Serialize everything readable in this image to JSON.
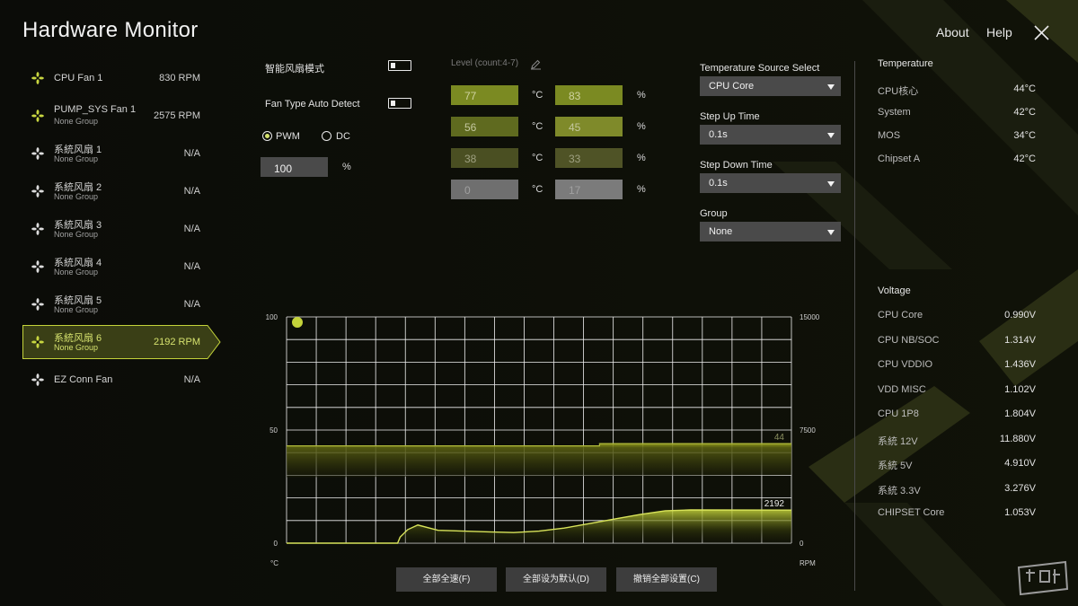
{
  "app": {
    "title": "Hardware Monitor",
    "about": "About",
    "help": "Help"
  },
  "fans": [
    {
      "name": "CPU Fan 1",
      "group": "",
      "value": "830 RPM",
      "active": false
    },
    {
      "name": "PUMP_SYS Fan 1",
      "group": "None Group",
      "value": "2575 RPM",
      "active": false
    },
    {
      "name": "系統风扇 1",
      "group": "None Group",
      "value": "N/A",
      "active": false
    },
    {
      "name": "系統风扇 2",
      "group": "None Group",
      "value": "N/A",
      "active": false
    },
    {
      "name": "系統风扇 3",
      "group": "None Group",
      "value": "N/A",
      "active": false
    },
    {
      "name": "系統风扇 4",
      "group": "None Group",
      "value": "N/A",
      "active": false
    },
    {
      "name": "系統风扇 5",
      "group": "None Group",
      "value": "N/A",
      "active": false
    },
    {
      "name": "系統风扇 6",
      "group": "None Group",
      "value": "2192 RPM",
      "active": true
    },
    {
      "name": "EZ Conn Fan",
      "group": "",
      "value": "N/A",
      "active": false
    }
  ],
  "settings": {
    "smart_fan_label": "智能风扇模式",
    "auto_detect_label": "Fan Type Auto Detect",
    "pwm_label": "PWM",
    "dc_label": "DC",
    "selected_mode": "PWM",
    "duty_value": "100",
    "duty_unit": "%"
  },
  "levels": {
    "header": "Level (count:4-7)",
    "temp_unit": "°C",
    "speed_unit": "%",
    "rows": [
      {
        "temp": "77",
        "speed": "83"
      },
      {
        "temp": "56",
        "speed": "45"
      },
      {
        "temp": "38",
        "speed": "33"
      },
      {
        "temp": "0",
        "speed": "17"
      }
    ]
  },
  "selects": {
    "temp_source_label": "Temperature Source Select",
    "temp_source_value": "CPU Core",
    "step_up_label": "Step Up Time",
    "step_up_value": "0.1s",
    "step_down_label": "Step Down Time",
    "step_down_value": "0.1s",
    "group_label": "Group",
    "group_value": "None"
  },
  "temperature": {
    "title": "Temperature",
    "items": [
      {
        "name": "CPU核心",
        "value": "44°C"
      },
      {
        "name": "System",
        "value": "42°C"
      },
      {
        "name": "MOS",
        "value": "34°C"
      },
      {
        "name": "Chipset A",
        "value": "42°C"
      }
    ]
  },
  "voltage": {
    "title": "Voltage",
    "items": [
      {
        "name": "CPU Core",
        "value": "0.990V"
      },
      {
        "name": "CPU NB/SOC",
        "value": "1.314V"
      },
      {
        "name": "CPU VDDIO",
        "value": "1.436V"
      },
      {
        "name": "VDD MISC",
        "value": "1.102V"
      },
      {
        "name": "CPU 1P8",
        "value": "1.804V"
      },
      {
        "name": "系統 12V",
        "value": "11.880V"
      },
      {
        "name": "系統 5V",
        "value": "4.910V"
      },
      {
        "name": "系統 3.3V",
        "value": "3.276V"
      },
      {
        "name": "CHIPSET Core",
        "value": "1.053V"
      }
    ]
  },
  "chart_data": {
    "type": "line",
    "left_axis": {
      "unit": "°C",
      "ticks": [
        "0",
        "50",
        "100"
      ],
      "range": [
        0,
        100
      ]
    },
    "right_axis": {
      "unit": "RPM",
      "ticks": [
        "0",
        "7500",
        "15000"
      ],
      "range": [
        0,
        15000
      ]
    },
    "series": [
      {
        "axis": "left",
        "current_label": "44",
        "points": [
          [
            0,
            43
          ],
          [
            62,
            43
          ],
          [
            62,
            44
          ],
          [
            100,
            44
          ]
        ]
      },
      {
        "axis": "right",
        "current_label": "2192",
        "points": [
          [
            0,
            0
          ],
          [
            22,
            0
          ],
          [
            22.5,
            400
          ],
          [
            24,
            900
          ],
          [
            26,
            1200
          ],
          [
            30,
            850
          ],
          [
            40,
            750
          ],
          [
            45,
            700
          ],
          [
            50,
            800
          ],
          [
            55,
            1000
          ],
          [
            60,
            1300
          ],
          [
            65,
            1600
          ],
          [
            70,
            1900
          ],
          [
            75,
            2150
          ],
          [
            80,
            2200
          ],
          [
            100,
            2192
          ]
        ]
      }
    ]
  },
  "buttons": {
    "full_speed": "全部全速(F)",
    "set_default": "全部设为默认(D)",
    "undo_all": "撤销全部设置(C)"
  },
  "colors": {
    "accent": "#c4d33a",
    "panel": "#4a4a4a",
    "grid": "#f0f0f0"
  }
}
